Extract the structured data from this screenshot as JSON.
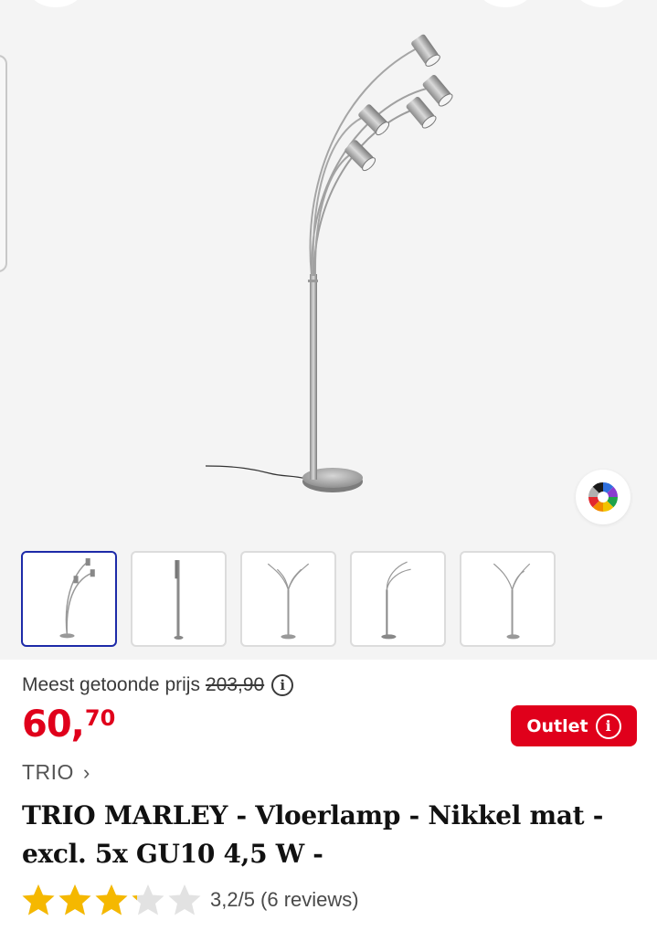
{
  "product": {
    "reference_label": "Meest getoonde prijs",
    "reference_price": "203,90",
    "info_glyph": "i",
    "price_euros": "60",
    "price_separator": ",",
    "price_cents": "70",
    "outlet_label": "Outlet",
    "brand": "TRIO",
    "brand_chevron": "›",
    "title": "TRIO MARLEY - Vloerlamp - Nikkel mat - excl. 5x GU10 4,5 W -",
    "rating_value": 3.2,
    "rating_max": 5,
    "rating_text": "3,2/5 (6 reviews)"
  },
  "gallery": {
    "thumbnail_count": 5,
    "selected_thumbnail": 1,
    "color_wheel_icon": "color-palette-icon"
  },
  "colors": {
    "price_red": "#e0001b",
    "selected_border": "#1d2aa8",
    "star_gold": "#f5b800",
    "star_empty": "#e2e2e2"
  }
}
